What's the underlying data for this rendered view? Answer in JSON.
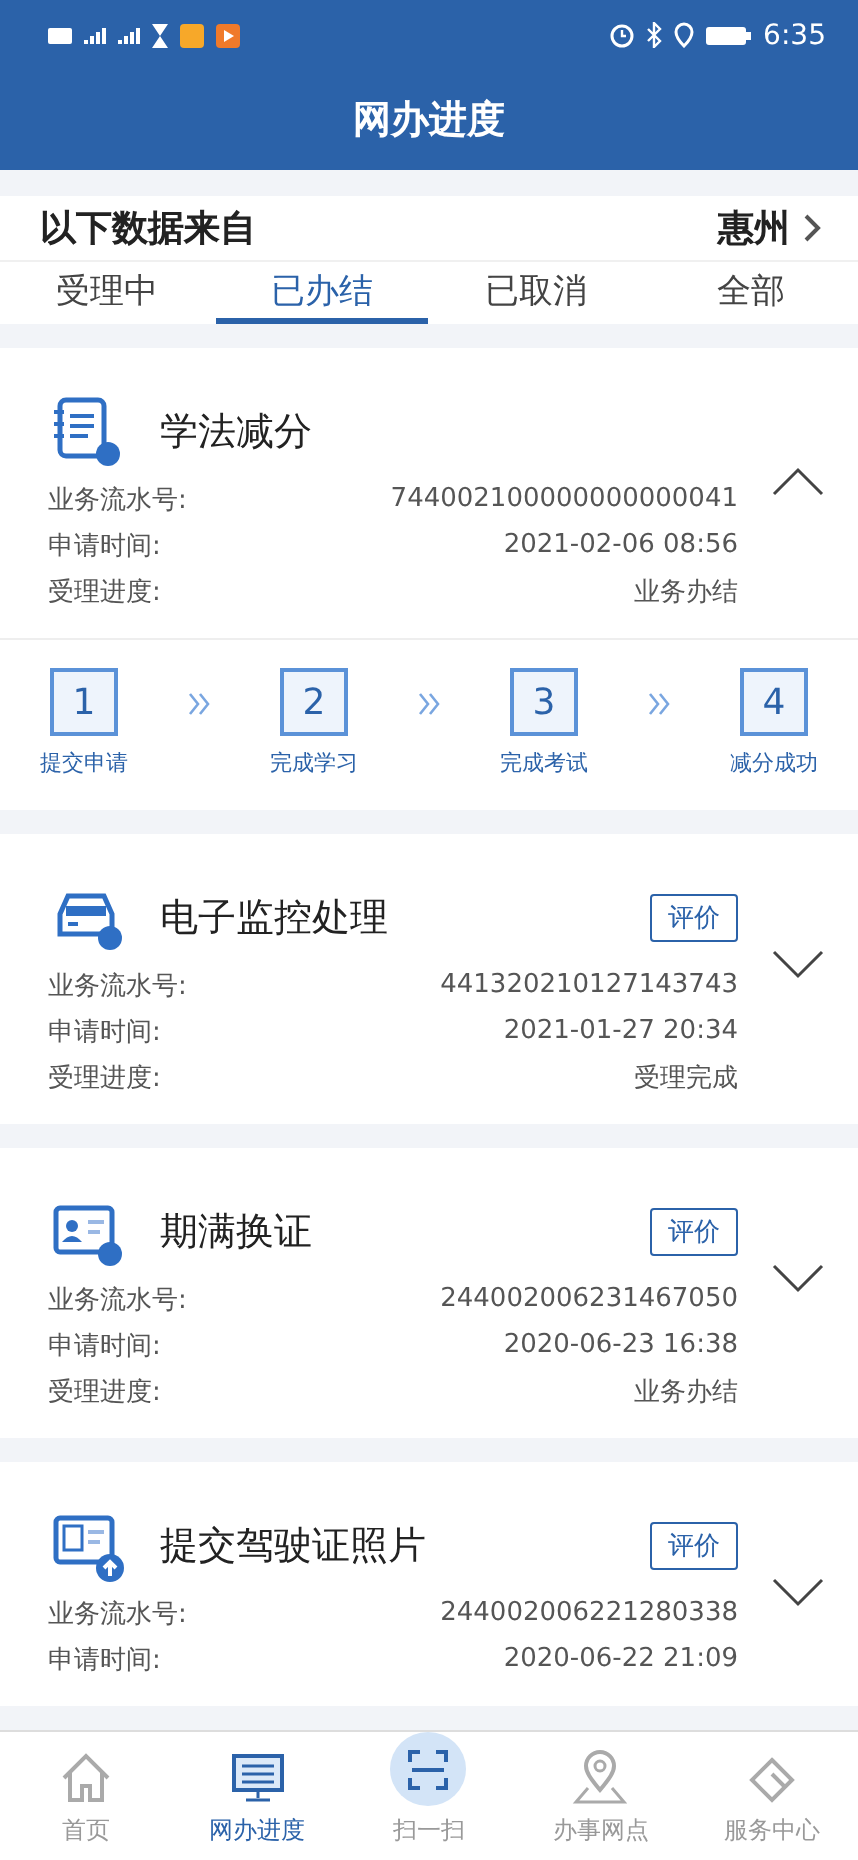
{
  "status_bar": {
    "time": "6:35"
  },
  "header": {
    "title": "网办进度"
  },
  "source": {
    "label": "以下数据来自",
    "city": "惠州"
  },
  "tabs": [
    {
      "label": "受理中",
      "selected": false
    },
    {
      "label": "已办结",
      "selected": true
    },
    {
      "label": "已取消",
      "selected": false
    },
    {
      "label": "全部",
      "selected": false
    }
  ],
  "records": [
    {
      "kind": "study",
      "title": "学法减分",
      "expanded": true,
      "fields": [
        {
          "label": "业务流水号:",
          "value": "744002100000000000041"
        },
        {
          "label": "申请时间:",
          "value": "2021-02-06 08:56"
        },
        {
          "label": "受理进度:",
          "value": "业务办结"
        }
      ],
      "steps": [
        {
          "number": "1",
          "label": "提交申请"
        },
        {
          "number": "2",
          "label": "完成学习"
        },
        {
          "number": "3",
          "label": "完成考试"
        },
        {
          "number": "4",
          "label": "减分成功"
        }
      ]
    },
    {
      "kind": "car",
      "title": "电子监控处理",
      "expanded": false,
      "rate_button": "评价",
      "fields": [
        {
          "label": "业务流水号:",
          "value": "441320210127143743"
        },
        {
          "label": "申请时间:",
          "value": "2021-01-27 20:34"
        },
        {
          "label": "受理进度:",
          "value": "受理完成"
        }
      ]
    },
    {
      "kind": "license",
      "title": "期满换证",
      "expanded": false,
      "rate_button": "评价",
      "fields": [
        {
          "label": "业务流水号:",
          "value": "244002006231467050"
        },
        {
          "label": "申请时间:",
          "value": "2020-06-23 16:38"
        },
        {
          "label": "受理进度:",
          "value": "业务办结"
        }
      ]
    },
    {
      "kind": "photo",
      "title": "提交驾驶证照片",
      "expanded": false,
      "rate_button": "评价",
      "fields": [
        {
          "label": "业务流水号:",
          "value": "244002006221280338"
        },
        {
          "label": "申请时间:",
          "value": "2020-06-22 21:09"
        }
      ]
    }
  ],
  "bottom_nav": [
    {
      "kind": "home",
      "label": "首页",
      "selected": false
    },
    {
      "kind": "progress",
      "label": "网办进度",
      "selected": true
    },
    {
      "kind": "scan",
      "label": "扫一扫",
      "selected": false
    },
    {
      "kind": "location",
      "label": "办事网点",
      "selected": false
    },
    {
      "kind": "service",
      "label": "服务中心",
      "selected": false
    }
  ]
}
